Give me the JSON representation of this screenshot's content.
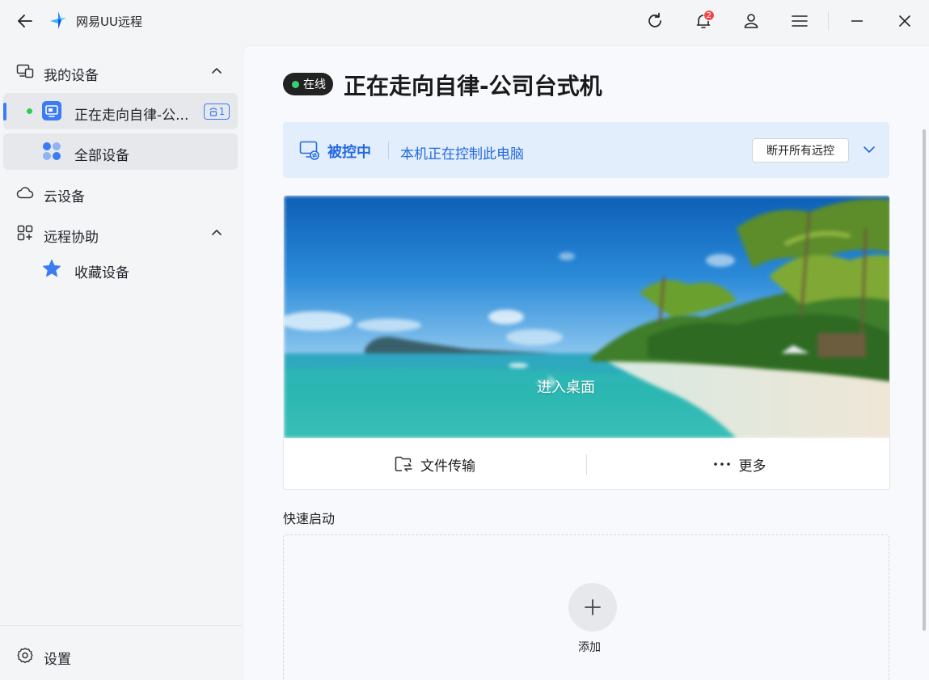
{
  "app": {
    "title": "网易UU远程"
  },
  "titlebar": {
    "notification_count": "2"
  },
  "sidebar": {
    "my_devices": "我的设备",
    "current_device": "正在走向自律-公...",
    "current_device_conn_count": "1",
    "all_devices": "全部设备",
    "cloud_devices": "云设备",
    "remote_assist": "远程协助",
    "favorites": "收藏设备",
    "settings": "设置"
  },
  "main": {
    "status": "在线",
    "device_name": "正在走向自律-公司台式机",
    "controlled_title": "被控中",
    "controlled_desc": "本机正在控制此电脑",
    "disconnect_label": "断开所有远控",
    "enter_desktop": "进入桌面",
    "file_transfer": "文件传输",
    "more": "更多",
    "quick_launch_title": "快速启动",
    "add_label": "添加"
  },
  "colors": {
    "accent": "#3b7cf5",
    "online": "#34d074",
    "controlled_text": "#2569e0",
    "controlled_bg": "#e2eefc"
  }
}
